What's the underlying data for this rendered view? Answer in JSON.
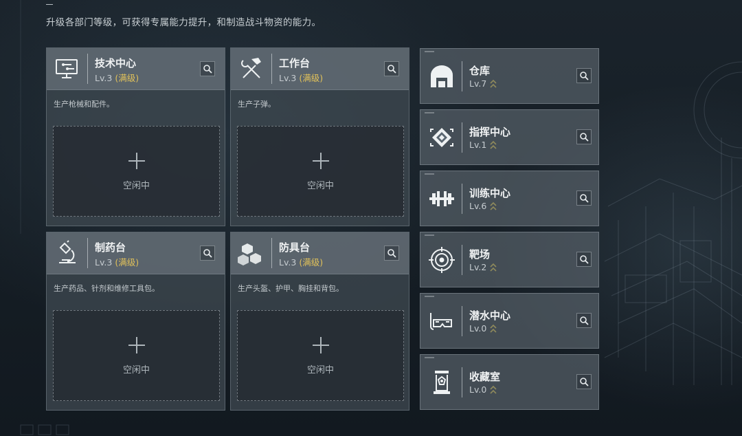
{
  "header": {
    "subtitle": "升级各部门等级，可获得专属能力提升，和制造战斗物资的能力。"
  },
  "production": [
    {
      "name": "技术中心",
      "level": "Lv.3",
      "status": "(满级)",
      "desc": "生产枪械和配件。",
      "slot_label": "空闲中",
      "icon": "computer-icon"
    },
    {
      "name": "工作台",
      "level": "Lv.3",
      "status": "(满级)",
      "desc": "生产子弹。",
      "slot_label": "空闲中",
      "icon": "tools-icon"
    },
    {
      "name": "制药台",
      "level": "Lv.3",
      "status": "(满级)",
      "desc": "生产药品、针剂和维修工具包。",
      "slot_label": "空闲中",
      "icon": "microscope-icon"
    },
    {
      "name": "防具台",
      "level": "Lv.3",
      "status": "(满级)",
      "desc": "生产头盔、护甲、胸挂和背包。",
      "slot_label": "空闲中",
      "icon": "cubes-icon"
    }
  ],
  "buildings": [
    {
      "name": "仓库",
      "level": "Lv.7",
      "icon": "warehouse-icon"
    },
    {
      "name": "指挥中心",
      "level": "Lv.1",
      "icon": "command-chip-icon"
    },
    {
      "name": "训练中心",
      "level": "Lv.6",
      "icon": "dumbbell-icon"
    },
    {
      "name": "靶场",
      "level": "Lv.2",
      "icon": "target-icon"
    },
    {
      "name": "潜水中心",
      "level": "Lv.0",
      "icon": "diving-mask-icon"
    },
    {
      "name": "收藏室",
      "level": "Lv.0",
      "icon": "display-case-icon"
    }
  ],
  "colors": {
    "accent_max": "#e2c25a",
    "upgrade_chevron": "#8f8a5c"
  }
}
